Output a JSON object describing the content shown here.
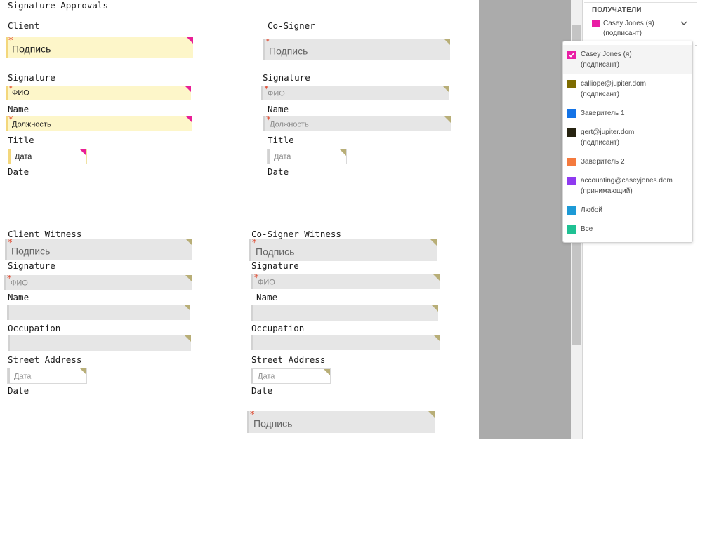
{
  "document": {
    "title": "Signature Approvals",
    "labels": {
      "client": "Client",
      "co_signer": "Co-Signer",
      "signature": "Signature",
      "name": "Name",
      "title": "Title",
      "date": "Date",
      "client_witness": "Client Witness",
      "co_signer_witness": "Co-Signer Witness",
      "occupation": "Occupation",
      "street_address": "Street Address"
    },
    "field_text": {
      "signature": "Подпись",
      "full_name": "ФИО",
      "job_title": "Должность",
      "date": "Дата"
    }
  },
  "recipients_panel": {
    "title": "ПОЛУЧАТЕЛИ",
    "selected": {
      "name": "Casey Jones (я)",
      "role": "(подписант)",
      "color": "#e91ea5"
    },
    "dropdown": [
      {
        "name": "Casey Jones (я)",
        "role": "(подписант)",
        "color": "#e91ea5",
        "checked": true
      },
      {
        "name": "calliope@jupiter.dom",
        "role": "(подписант)",
        "color": "#7d6b00",
        "checked": false
      },
      {
        "name": "Заверитель 1",
        "role": "",
        "color": "#1473e6",
        "checked": false
      },
      {
        "name": "gert@jupiter.dom",
        "role": "(подписант)",
        "color": "#262311",
        "checked": false
      },
      {
        "name": "Заверитель 2",
        "role": "",
        "color": "#f47a3e",
        "checked": false
      },
      {
        "name": "accounting@caseyjones.dom",
        "role": "(принимающий)",
        "color": "#8f3af0",
        "checked": false
      },
      {
        "name": "Любой",
        "role": "",
        "color": "#1d9ad6",
        "checked": false
      },
      {
        "name": "Все",
        "role": "",
        "color": "#1fc193",
        "checked": false
      }
    ]
  }
}
